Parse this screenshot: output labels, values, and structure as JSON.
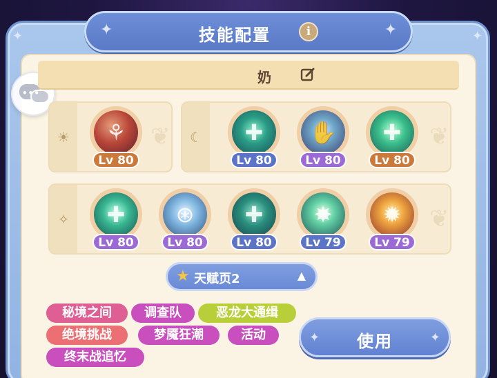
{
  "header": {
    "title": "技能配置",
    "info_icon": "info-icon",
    "info_symbol": "i"
  },
  "chat": {
    "icon": "chat-bubble-icon",
    "dots": "•••"
  },
  "profile": {
    "name": "奶",
    "edit_icon": "edit-pencil-icon"
  },
  "groups": [
    {
      "icon": "sun-icon",
      "symbol": "☀",
      "skills": [
        {
          "level": "Lv 80",
          "badge": "orange",
          "art": "red"
        }
      ]
    },
    {
      "icon": "moon-icon",
      "symbol": "☾",
      "skills": [
        {
          "level": "Lv 80",
          "badge": "blue",
          "art": "teal-hand"
        },
        {
          "level": "Lv 80",
          "badge": "purple",
          "art": "purple-hand"
        },
        {
          "level": "Lv 80",
          "badge": "orange",
          "art": "teal-heal"
        }
      ]
    },
    {
      "icon": "sparkle-icon",
      "symbol": "✧",
      "skills": [
        {
          "level": "Lv 80",
          "badge": "purple",
          "art": "teal-cross"
        },
        {
          "level": "Lv 80",
          "badge": "purple",
          "art": "blue-beam"
        },
        {
          "level": "Lv 80",
          "badge": "blue",
          "art": "teal-wave"
        },
        {
          "level": "Lv 79",
          "badge": "blue",
          "art": "green-star"
        },
        {
          "level": "Lv 79",
          "badge": "purple",
          "art": "fire-burst"
        }
      ]
    }
  ],
  "talent": {
    "label": "天赋页2",
    "star": "★",
    "caret": "▲"
  },
  "tags": [
    "秘境之间",
    "调查队",
    "恶龙大通缉",
    "绝境挑战",
    "梦魇狂潮",
    "活动",
    "终末战追忆"
  ],
  "action": {
    "use_label": "使用"
  },
  "colors": {
    "frame": "#92b3e2",
    "panel": "#fbf4e4",
    "banner": "#5a79c6",
    "lv_orange": "#cc7a3b",
    "lv_blue": "#5b74c8",
    "lv_purple": "#9c6ad6",
    "tag_pink": "#df5e93",
    "tag_magenta": "#c84fbd",
    "tag_lime": "#b9cf3a",
    "tag_salmon": "#ec6f73"
  }
}
